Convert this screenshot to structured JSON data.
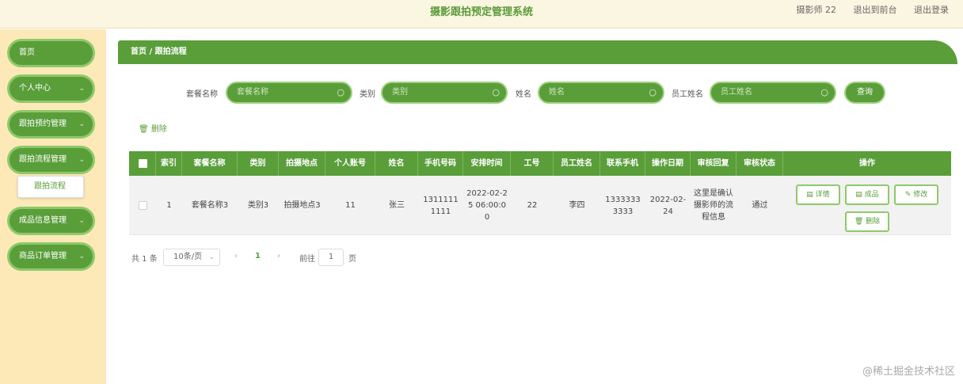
{
  "header": {
    "title": "摄影跟拍预定管理系统",
    "user_label": "摄影师 22",
    "back_front": "退出到前台",
    "logout": "退出登录"
  },
  "sidebar": {
    "items": [
      {
        "label": "首页",
        "chevron": ""
      },
      {
        "label": "个人中心",
        "chevron": "⌄"
      },
      {
        "label": "跟拍预约管理",
        "chevron": "⌄"
      },
      {
        "label": "跟拍流程管理",
        "chevron": "⌄"
      },
      {
        "label": "成品信息管理",
        "chevron": "⌄"
      },
      {
        "label": "商品订单管理",
        "chevron": "⌄"
      }
    ],
    "submenu_item": "跟拍流程"
  },
  "breadcrumb": {
    "text": "首页 / 跟拍流程"
  },
  "search": {
    "fields": [
      {
        "label": "套餐名称",
        "placeholder": "套餐名称"
      },
      {
        "label": "类别",
        "placeholder": "类别"
      },
      {
        "label": "姓名",
        "placeholder": "姓名"
      },
      {
        "label": "员工姓名",
        "placeholder": "员工姓名"
      }
    ],
    "query_button": "查询"
  },
  "toolbar": {
    "delete_label": "删除",
    "delete_icon": "trash-icon"
  },
  "table": {
    "headers": [
      "",
      "索引",
      "套餐名称",
      "类别",
      "拍摄地点",
      "个人账号",
      "姓名",
      "手机号码",
      "安排时间",
      "工号",
      "员工姓名",
      "联系手机",
      "操作日期",
      "审核回复",
      "审核状态",
      "操作"
    ],
    "rows": [
      {
        "index": "1",
        "package_name": "套餐名称3",
        "category": "类别3",
        "location": "拍摄地点3",
        "account": "11",
        "name": "张三",
        "phone": "13111111111",
        "schedule_time": "2022-02-25 06:00:00",
        "job_no": "22",
        "staff_name": "李四",
        "contact_phone": "13333333333",
        "op_date": "2022-02-24",
        "review_reply": "这里是确认摄影师的流程信息",
        "review_status": "通过",
        "actions": {
          "detail": "详情",
          "product": "成品",
          "edit": "修改",
          "delete": "删除"
        }
      }
    ]
  },
  "pagination": {
    "total": "共 1 条",
    "page_size": "10条/页",
    "prev": "‹",
    "current": "1",
    "next": "›",
    "goto_label": "前往",
    "goto_value": "1",
    "page_unit": "页"
  },
  "watermark": "@稀土掘金技术社区",
  "colors": {
    "primary": "#5a9e3a",
    "sidebar_bg": "#fde9b8",
    "topbar_bg": "#fbf6e1"
  }
}
